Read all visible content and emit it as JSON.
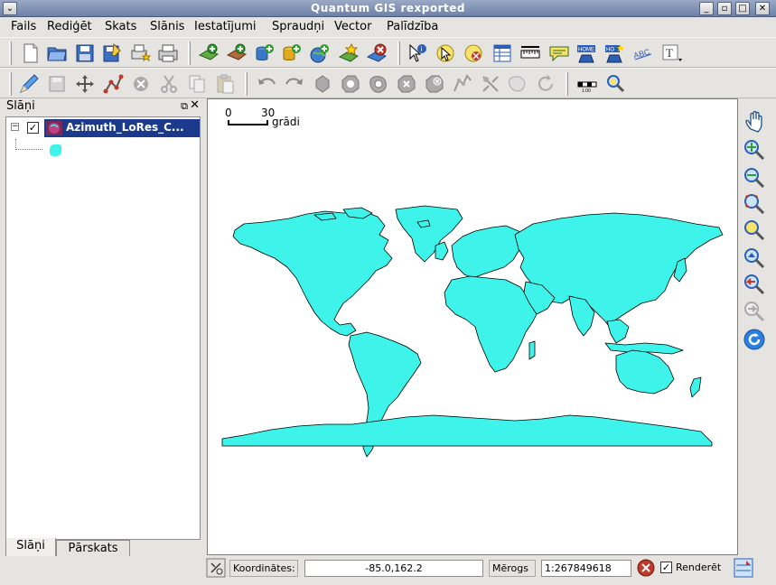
{
  "window": {
    "title": "Quantum GIS rexported",
    "controls": [
      "chevron-down-icon",
      "maximize-icon",
      "minimize-icon",
      "restore-icon",
      "close-icon"
    ]
  },
  "menubar": {
    "items": [
      {
        "label": "Fails"
      },
      {
        "label": "Rediģēt"
      },
      {
        "label": "Skats"
      },
      {
        "label": "Slānis"
      },
      {
        "label": "Iestatījumi"
      },
      {
        "label": "Spraudņi"
      },
      {
        "label": "Vector"
      },
      {
        "label": "Palīdzība"
      }
    ]
  },
  "toolbar_file_icons": [
    "new-project-icon",
    "open-project-icon",
    "save-project-icon",
    "save-as-icon",
    "print-composer-icon",
    "print-icon"
  ],
  "toolbar_layer_icons": [
    "add-vector-layer-icon",
    "add-raster-layer-icon",
    "add-postgis-layer-icon",
    "add-spatialite-layer-icon",
    "add-wms-layer-icon",
    "new-vector-layer-icon",
    "remove-layer-icon"
  ],
  "toolbar_attr_icons": [
    "identify-icon",
    "select-icon",
    "deselect-icon",
    "attribute-table-icon",
    "measure-icon",
    "map-tips-icon",
    "home-icon",
    "new-bookmark-icon",
    "label-icon",
    "text-annotation-icon"
  ],
  "toolbar_edit_icons": [
    "toggle-editing-icon",
    "save-edits-icon",
    "move-feature-icon",
    "node-tool-icon",
    "delete-selected-icon",
    "cut-icon",
    "copy-icon",
    "paste-icon",
    "undo-icon",
    "redo-icon",
    "simplify-icon",
    "add-ring-icon",
    "add-part-icon",
    "delete-ring-icon",
    "delete-part-icon",
    "reshape-icon",
    "split-icon",
    "merge-icon",
    "rotate-icon",
    "refresh-icon",
    "scale-icon",
    "zoom-selection-icon"
  ],
  "left_panel": {
    "title": "Slāņi",
    "layer": {
      "label": "Azimuth_LoRes_C...",
      "checked": "✓",
      "expander": "−",
      "fill_color": "#3ef4ea"
    },
    "tabs": [
      {
        "label": "Slāņi",
        "active": true
      },
      {
        "label": "Pārskats",
        "active": false
      }
    ]
  },
  "map": {
    "scalebar": {
      "start": "0",
      "end": "30",
      "unit": "grādi"
    },
    "land_color": "#3ef4ea",
    "background": "#ffffff"
  },
  "right_toolbar": [
    "pan-icon",
    "zoom-in-icon",
    "zoom-out-icon",
    "zoom-full-icon",
    "zoom-layer-icon",
    "zoom-selection-icon",
    "zoom-last-icon",
    "zoom-next-icon",
    "refresh-map-icon"
  ],
  "status": {
    "coordinates_label": "Koordinātes:",
    "coordinates_value": "-85.0,162.2",
    "scale_label": "Mērogs",
    "scale_value": "1:267849618",
    "render_label": "Renderēt",
    "render_checked": "✓"
  }
}
